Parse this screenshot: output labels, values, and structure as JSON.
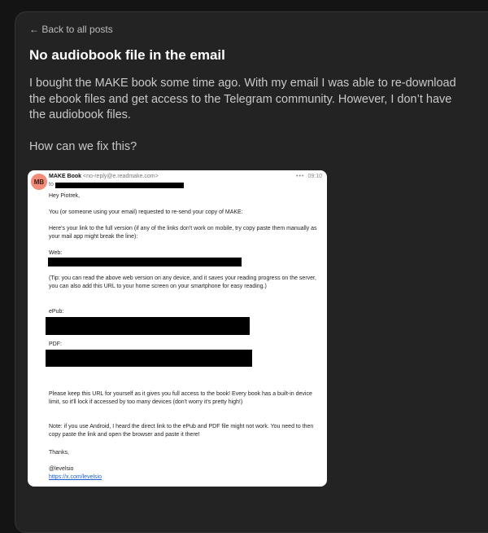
{
  "nav": {
    "back_label": "← Back to all posts"
  },
  "post": {
    "title": "No audiobook file in the email",
    "paragraphs": [
      "I bought the MAKE book some time ago. With my email I was able to re-download the ebook files and get access to the Telegram community. However, I don’t have the audiobook files.",
      "How can we fix this?"
    ]
  },
  "email": {
    "avatar_initials": "MB",
    "sender_name": "MAKE Book",
    "sender_address": "<no-reply@e.readmake.com>",
    "to_label": "to",
    "time": "09:10",
    "menu_icon": "more-dots-icon",
    "avatar_color": "#f08c78",
    "link_color": "#1a5fd6",
    "greeting": "Hey Piotrek,",
    "intro": "You (or someone using your email) requested to re-send your copy of MAKE:",
    "links_intro": "Here's your link to the full version (if any of the links don't work on mobile, try copy paste them manually as your mail app might break the line):",
    "web_label": "Web:",
    "tip": "(Tip: you can read the above web version on any device, and it saves your reading progress on the server, you can also add this URL to your home screen on your smartphone for easy reading.)",
    "epub_label": "ePub:",
    "pdf_label": "PDF:",
    "keep_note": "Please keep this URL for yourself as it gives you full access to the book! Every book has a built-in device limit, so it'll lock if accessed by too many devices (don't worry it's pretty high!)",
    "android_note": "Note: if you use Android, I heard the direct link to the ePub and PDF file might not work. You need to then copy paste the link and open the browser and paste it there!",
    "thanks": "Thanks,",
    "signature": "@levelsio",
    "signature_link": "https://x.com/levelsio"
  }
}
